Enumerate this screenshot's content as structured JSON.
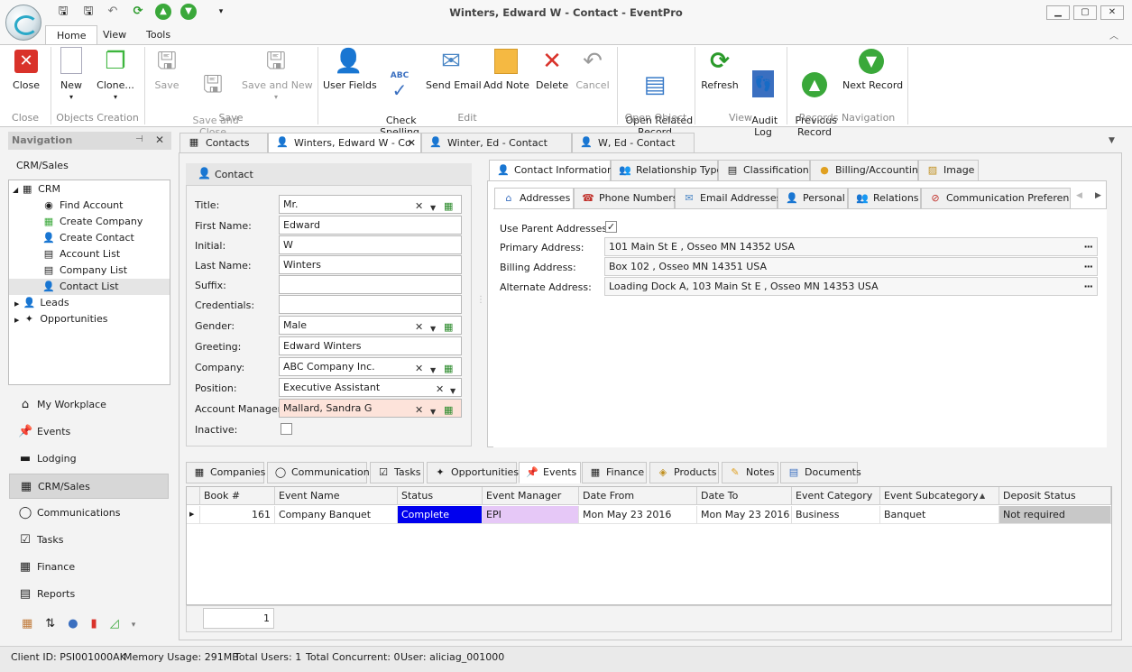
{
  "window": {
    "title": "Winters, Edward W - Contact - EventPro"
  },
  "ribbon": {
    "tabs": [
      {
        "label": "Home"
      },
      {
        "label": "View"
      },
      {
        "label": "Tools"
      }
    ],
    "close": "Close",
    "new": "New",
    "clone": "Clone...",
    "save": "Save",
    "save_close": "Save and\nClose",
    "save_new": "Save and New",
    "user_fields": "User Fields",
    "check_spelling": "Check\nSpelling",
    "send_email": "Send Email",
    "add_note": "Add Note",
    "delete": "Delete",
    "cancel": "Cancel",
    "open_related": "Open Related\nRecord",
    "refresh": "Refresh",
    "audit_log": "Audit\nLog",
    "previous": "Previous\nRecord",
    "next": "Next Record",
    "groups": {
      "close": "Close",
      "objects": "Objects Creation",
      "save": "Save",
      "edit": "Edit",
      "open_object": "Open Object",
      "view": "View",
      "records_nav": "Records Navigation"
    },
    "abc": "ABC"
  },
  "nav": {
    "header": "Navigation",
    "section": "CRM/Sales",
    "tree": {
      "crm": "CRM",
      "find_account": "Find Account",
      "create_company": "Create Company",
      "create_contact": "Create Contact",
      "account_list": "Account List",
      "company_list": "Company List",
      "contact_list": "Contact List",
      "leads": "Leads",
      "opportunities": "Opportunities"
    },
    "sections": [
      {
        "label": "My Workplace"
      },
      {
        "label": "Events"
      },
      {
        "label": "Lodging"
      },
      {
        "label": "CRM/Sales"
      },
      {
        "label": "Communications"
      },
      {
        "label": "Tasks"
      },
      {
        "label": "Finance"
      },
      {
        "label": "Reports"
      }
    ]
  },
  "doc_tabs": [
    {
      "label": "Contacts"
    },
    {
      "label": "Winters, Edward W - Co"
    },
    {
      "label": "Winter, Ed - Contact"
    },
    {
      "label": "W, Ed  - Contact"
    }
  ],
  "contact": {
    "header": "Contact",
    "labels": {
      "title": "Title:",
      "first": "First Name:",
      "initial": "Initial:",
      "last": "Last Name:",
      "suffix": "Suffix:",
      "credentials": "Credentials:",
      "gender": "Gender:",
      "greeting": "Greeting:",
      "company": "Company:",
      "position": "Position:",
      "account_manager": "Account Manager:",
      "inactive": "Inactive:"
    },
    "values": {
      "title": "Mr.",
      "first": "Edward",
      "initial": "W",
      "last": "Winters",
      "suffix": "",
      "credentials": "",
      "gender": "Male",
      "greeting": "Edward Winters",
      "company": "ABC Company Inc.",
      "position": "Executive Assistant",
      "account_manager": "Mallard, Sandra G"
    }
  },
  "contact_tabs": [
    {
      "label": "Contact Information"
    },
    {
      "label": "Relationship Type"
    },
    {
      "label": "Classification"
    },
    {
      "label": "Billing/Accounting"
    },
    {
      "label": "Image"
    }
  ],
  "sub_tabs": [
    {
      "label": "Addresses"
    },
    {
      "label": "Phone Numbers"
    },
    {
      "label": "Email Addresses"
    },
    {
      "label": "Personal"
    },
    {
      "label": "Relations"
    },
    {
      "label": "Communication Preferences"
    }
  ],
  "addresses": {
    "use_parent_label": "Use Parent Addresses:",
    "primary_label": "Primary Address:",
    "primary": "101 Main St E , Osseo MN 14352 USA",
    "billing_label": "Billing Address:",
    "billing": "Box 102 , Osseo MN 14351 USA",
    "alternate_label": "Alternate Address:",
    "alternate": "Loading Dock A, 103 Main St E , Osseo MN 14353 USA"
  },
  "bottom_tabs": [
    {
      "label": "Companies"
    },
    {
      "label": "Communications"
    },
    {
      "label": "Tasks"
    },
    {
      "label": "Opportunities"
    },
    {
      "label": "Events"
    },
    {
      "label": "Finance"
    },
    {
      "label": "Products"
    },
    {
      "label": "Notes"
    },
    {
      "label": "Documents"
    }
  ],
  "grid": {
    "columns": [
      "Book #",
      "Event Name",
      "Status",
      "Event Manager",
      "Date From",
      "Date To",
      "Event Category",
      "Event Subcategory",
      "Deposit Status"
    ],
    "row": [
      "161",
      "Company Banquet",
      "Complete",
      "EPI",
      "Mon May 23 2016",
      "Mon May 23 2016",
      "Business",
      "Banquet",
      "Not required"
    ],
    "count": "1",
    "status_color": "#0000ee",
    "manager_color": "#e6c8f7"
  },
  "status": {
    "client": "Client ID: PSI001000AK",
    "memory": "Memory Usage: 291MB",
    "users": "Total Users: 1",
    "concurrent": "Total Concurrent: 0",
    "user": "User: aliciag_001000"
  }
}
